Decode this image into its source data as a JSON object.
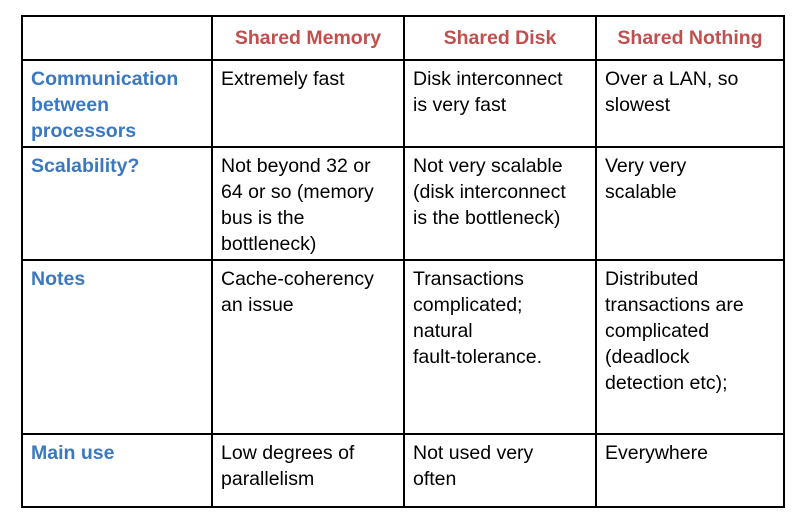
{
  "colors": {
    "column_header": "#c0504d",
    "row_header": "#3b78c2",
    "border": "#000000"
  },
  "columns": [
    "Shared Memory",
    "Shared Disk",
    "Shared Nothing"
  ],
  "rows": [
    {
      "label": "Communication\nbetween\nprocessors",
      "cells": [
        "Extremely fast",
        "Disk interconnect\nis very fast",
        "Over a LAN, so\nslowest"
      ]
    },
    {
      "label": "Scalability?",
      "cells": [
        "Not beyond 32 or\n64 or so (memory\nbus is the\nbottleneck)",
        "Not very scalable\n(disk interconnect\nis the bottleneck)",
        "Very very\nscalable"
      ]
    },
    {
      "label": "Notes",
      "cells": [
        "Cache-coherency\nan issue",
        "Transactions\ncomplicated;\nnatural\nfault-tolerance.",
        "Distributed\ntransactions are\ncomplicated\n(deadlock\ndetection etc);"
      ]
    },
    {
      "label": "Main use",
      "cells": [
        "Low degrees of\nparallelism",
        "Not used very\noften",
        "Everywhere"
      ]
    }
  ]
}
